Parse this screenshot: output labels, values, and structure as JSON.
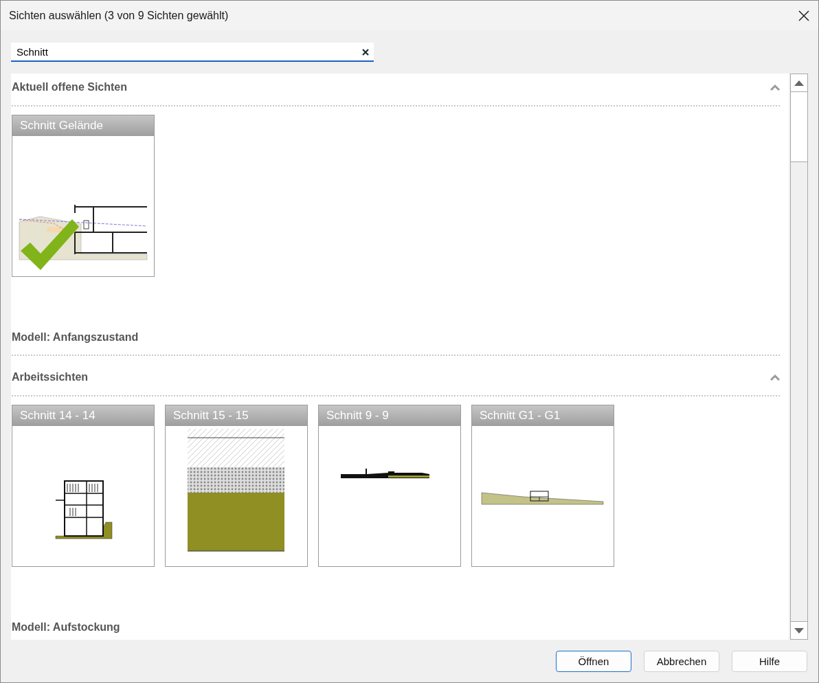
{
  "window": {
    "title": "Sichten auswählen (3 von 9 Sichten gewählt)"
  },
  "search": {
    "value": "Schnitt"
  },
  "sections": [
    {
      "kind": "group",
      "title": "Aktuell offene Sichten",
      "expanded": true,
      "views": [
        {
          "name": "Schnitt Gelände",
          "checked": true,
          "kind": "site"
        }
      ]
    },
    {
      "kind": "model",
      "title": "Modell: Anfangszustand"
    },
    {
      "kind": "group",
      "title": "Arbeitssichten",
      "expanded": true,
      "views": [
        {
          "name": "Schnitt 14 - 14",
          "checked": false,
          "kind": "building"
        },
        {
          "name": "Schnitt 15 - 15",
          "checked": false,
          "kind": "layers"
        },
        {
          "name": "Schnitt 9 - 9",
          "checked": false,
          "kind": "flat"
        },
        {
          "name": "Schnitt G1 - G1",
          "checked": false,
          "kind": "terrain"
        }
      ]
    },
    {
      "kind": "model",
      "title": "Modell: Aufstockung"
    }
  ],
  "buttons": [
    {
      "label": "Öffnen",
      "default": true
    },
    {
      "label": "Abbrechen",
      "default": false
    },
    {
      "label": "Hilfe",
      "default": false
    }
  ]
}
